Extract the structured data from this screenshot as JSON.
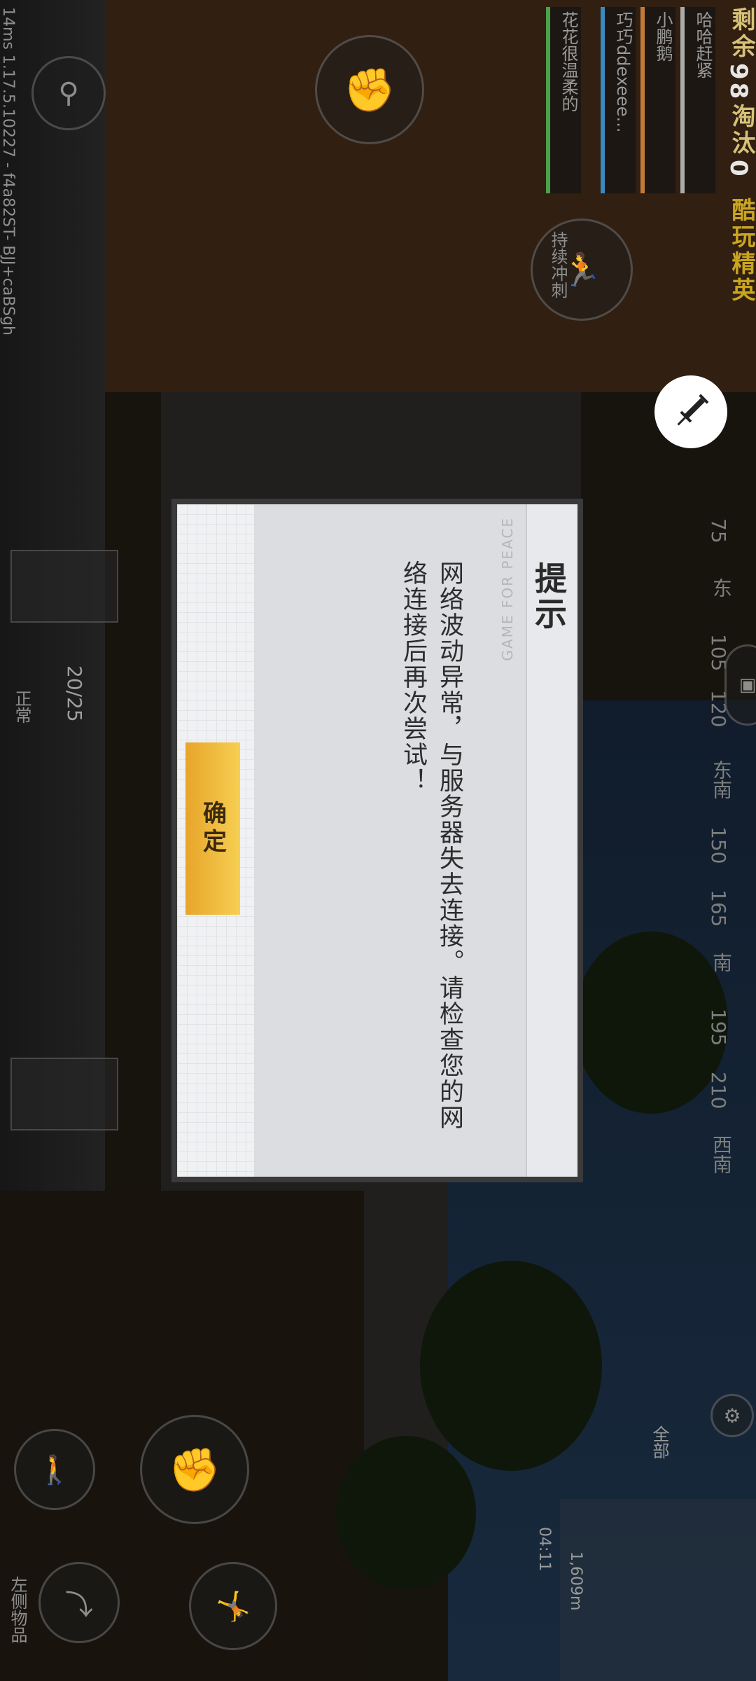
{
  "hud": {
    "remaining_label": "剩余",
    "remaining_count": "98",
    "eliminated_label": "淘汰",
    "eliminated_count": "0",
    "mode_label": "酷玩精英",
    "continuous_run_label": "持续冲刺",
    "ping_text": "14ms  1.17.5.10227 - f4a82ST- BJJ+caBSgh",
    "team": [
      {
        "slot": "1",
        "name": "哈哈赶紧"
      },
      {
        "slot": "2",
        "name": "小鹏鹅"
      },
      {
        "slot": "3",
        "name": "巧巧ddexeee..."
      },
      {
        "slot": "4",
        "name": "花花很温柔的"
      }
    ],
    "ammo_text": "20/25",
    "status_text": "正常",
    "distance_text": "1,609m",
    "timer_text": "04:11",
    "all_label": "全部",
    "bottom_label": "左侧物品",
    "compass": [
      "75",
      "东",
      "105",
      "120",
      "东南",
      "150",
      "165",
      "南",
      "195",
      "210",
      "西南"
    ]
  },
  "dialog": {
    "title": "提示",
    "watermark": "GAME FOR PEACE",
    "message": "网络波动异常，与服务器失去连接。请检查您的网络连接后再次尝试！",
    "confirm_label": "确定",
    "accent_color": "#f3c24a"
  }
}
